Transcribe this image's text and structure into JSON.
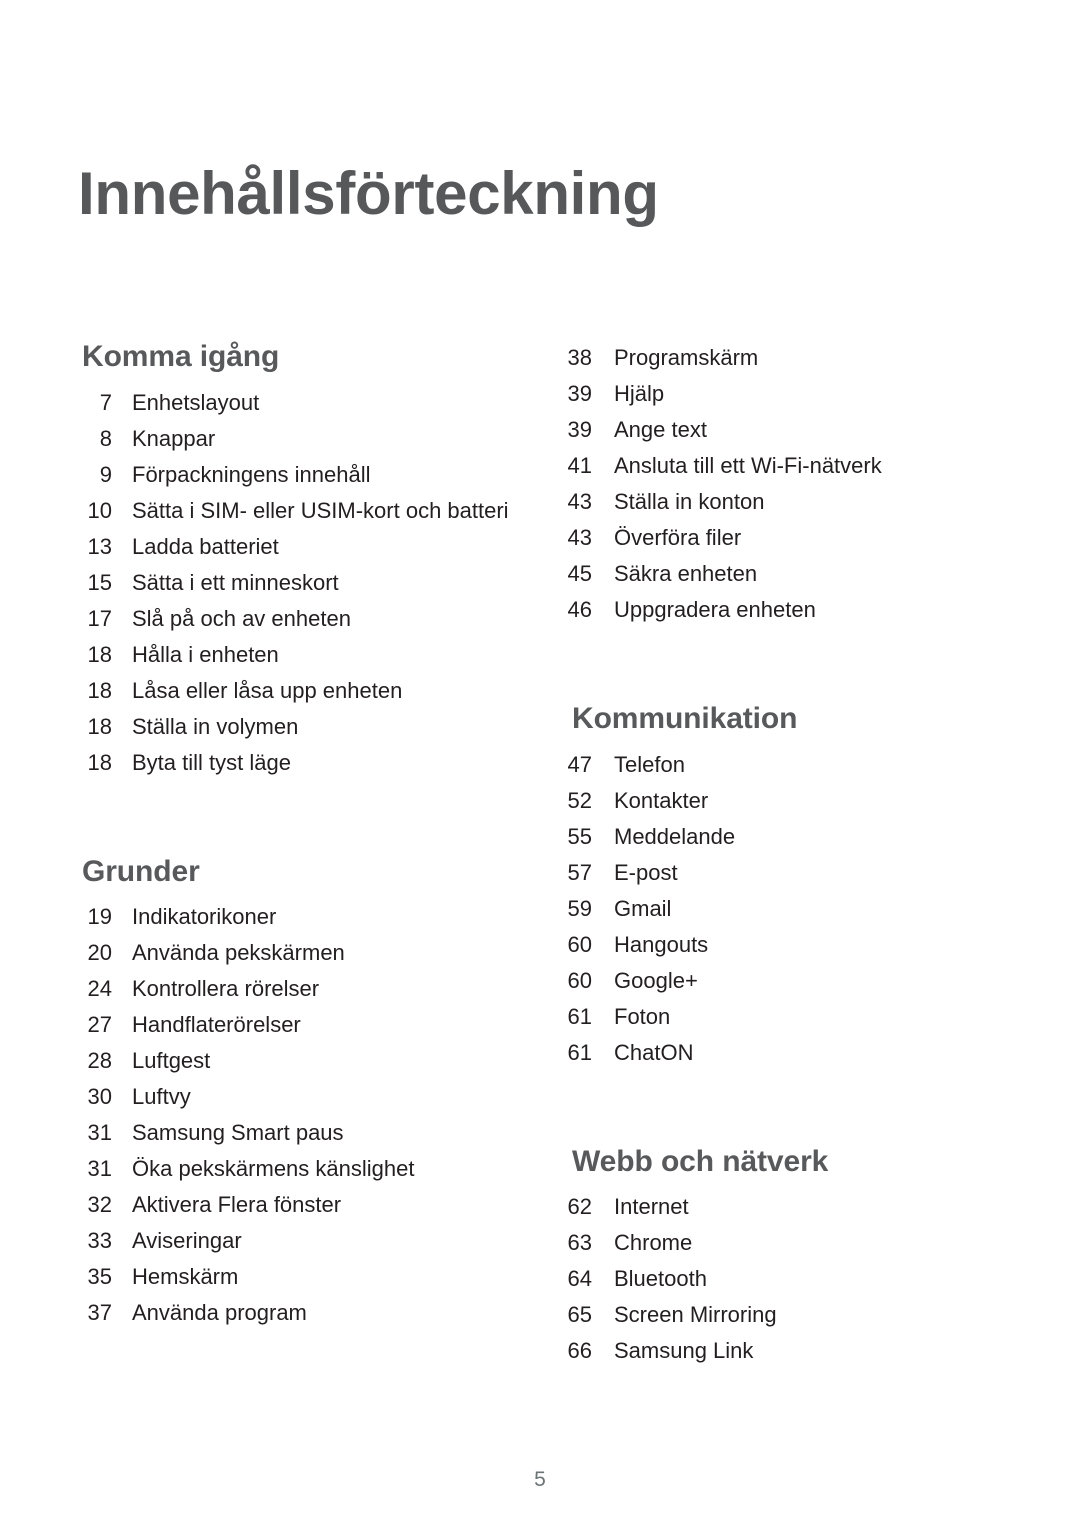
{
  "document": {
    "title": "Innehållsförteckning",
    "page_number": "5",
    "colors": {
      "heading": "#58595b",
      "body_text": "#231f20",
      "folio": "#6b7377",
      "background": "#ffffff"
    }
  },
  "columns": {
    "left": {
      "sections": [
        {
          "heading": "Komma igång",
          "entries": [
            {
              "page": "7",
              "label": "Enhetslayout"
            },
            {
              "page": "8",
              "label": "Knappar"
            },
            {
              "page": "9",
              "label": "Förpackningens innehåll"
            },
            {
              "page": "10",
              "label": "Sätta i SIM- eller USIM-kort och batteri"
            },
            {
              "page": "13",
              "label": "Ladda batteriet"
            },
            {
              "page": "15",
              "label": "Sätta i ett minneskort"
            },
            {
              "page": "17",
              "label": "Slå på och av enheten"
            },
            {
              "page": "18",
              "label": "Hålla i enheten"
            },
            {
              "page": "18",
              "label": "Låsa eller låsa upp enheten"
            },
            {
              "page": "18",
              "label": "Ställa in volymen"
            },
            {
              "page": "18",
              "label": "Byta till tyst läge"
            }
          ]
        },
        {
          "heading": "Grunder",
          "entries": [
            {
              "page": "19",
              "label": "Indikatorikoner"
            },
            {
              "page": "20",
              "label": "Använda pekskärmen"
            },
            {
              "page": "24",
              "label": "Kontrollera rörelser"
            },
            {
              "page": "27",
              "label": "Handflaterörelser"
            },
            {
              "page": "28",
              "label": "Luftgest"
            },
            {
              "page": "30",
              "label": "Luftvy"
            },
            {
              "page": "31",
              "label": "Samsung Smart paus"
            },
            {
              "page": "31",
              "label": "Öka pekskärmens känslighet"
            },
            {
              "page": "32",
              "label": "Aktivera Flera fönster"
            },
            {
              "page": "33",
              "label": "Aviseringar"
            },
            {
              "page": "35",
              "label": "Hemskärm"
            },
            {
              "page": "37",
              "label": "Använda program"
            }
          ]
        }
      ]
    },
    "right": {
      "sections": [
        {
          "heading": "",
          "entries": [
            {
              "page": "38",
              "label": "Programskärm"
            },
            {
              "page": "39",
              "label": "Hjälp"
            },
            {
              "page": "39",
              "label": "Ange text"
            },
            {
              "page": "41",
              "label": "Ansluta till ett Wi-Fi-nätverk"
            },
            {
              "page": "43",
              "label": "Ställa in konton"
            },
            {
              "page": "43",
              "label": "Överföra filer"
            },
            {
              "page": "45",
              "label": "Säkra enheten"
            },
            {
              "page": "46",
              "label": "Uppgradera enheten"
            }
          ]
        },
        {
          "heading": "Kommunikation",
          "entries": [
            {
              "page": "47",
              "label": "Telefon"
            },
            {
              "page": "52",
              "label": "Kontakter"
            },
            {
              "page": "55",
              "label": "Meddelande"
            },
            {
              "page": "57",
              "label": "E-post"
            },
            {
              "page": "59",
              "label": "Gmail"
            },
            {
              "page": "60",
              "label": "Hangouts"
            },
            {
              "page": "60",
              "label": "Google+"
            },
            {
              "page": "61",
              "label": "Foton"
            },
            {
              "page": "61",
              "label": "ChatON"
            }
          ]
        },
        {
          "heading": "Webb och nätverk",
          "entries": [
            {
              "page": "62",
              "label": "Internet"
            },
            {
              "page": "63",
              "label": "Chrome"
            },
            {
              "page": "64",
              "label": "Bluetooth"
            },
            {
              "page": "65",
              "label": "Screen Mirroring"
            },
            {
              "page": "66",
              "label": "Samsung Link"
            }
          ]
        }
      ]
    }
  }
}
